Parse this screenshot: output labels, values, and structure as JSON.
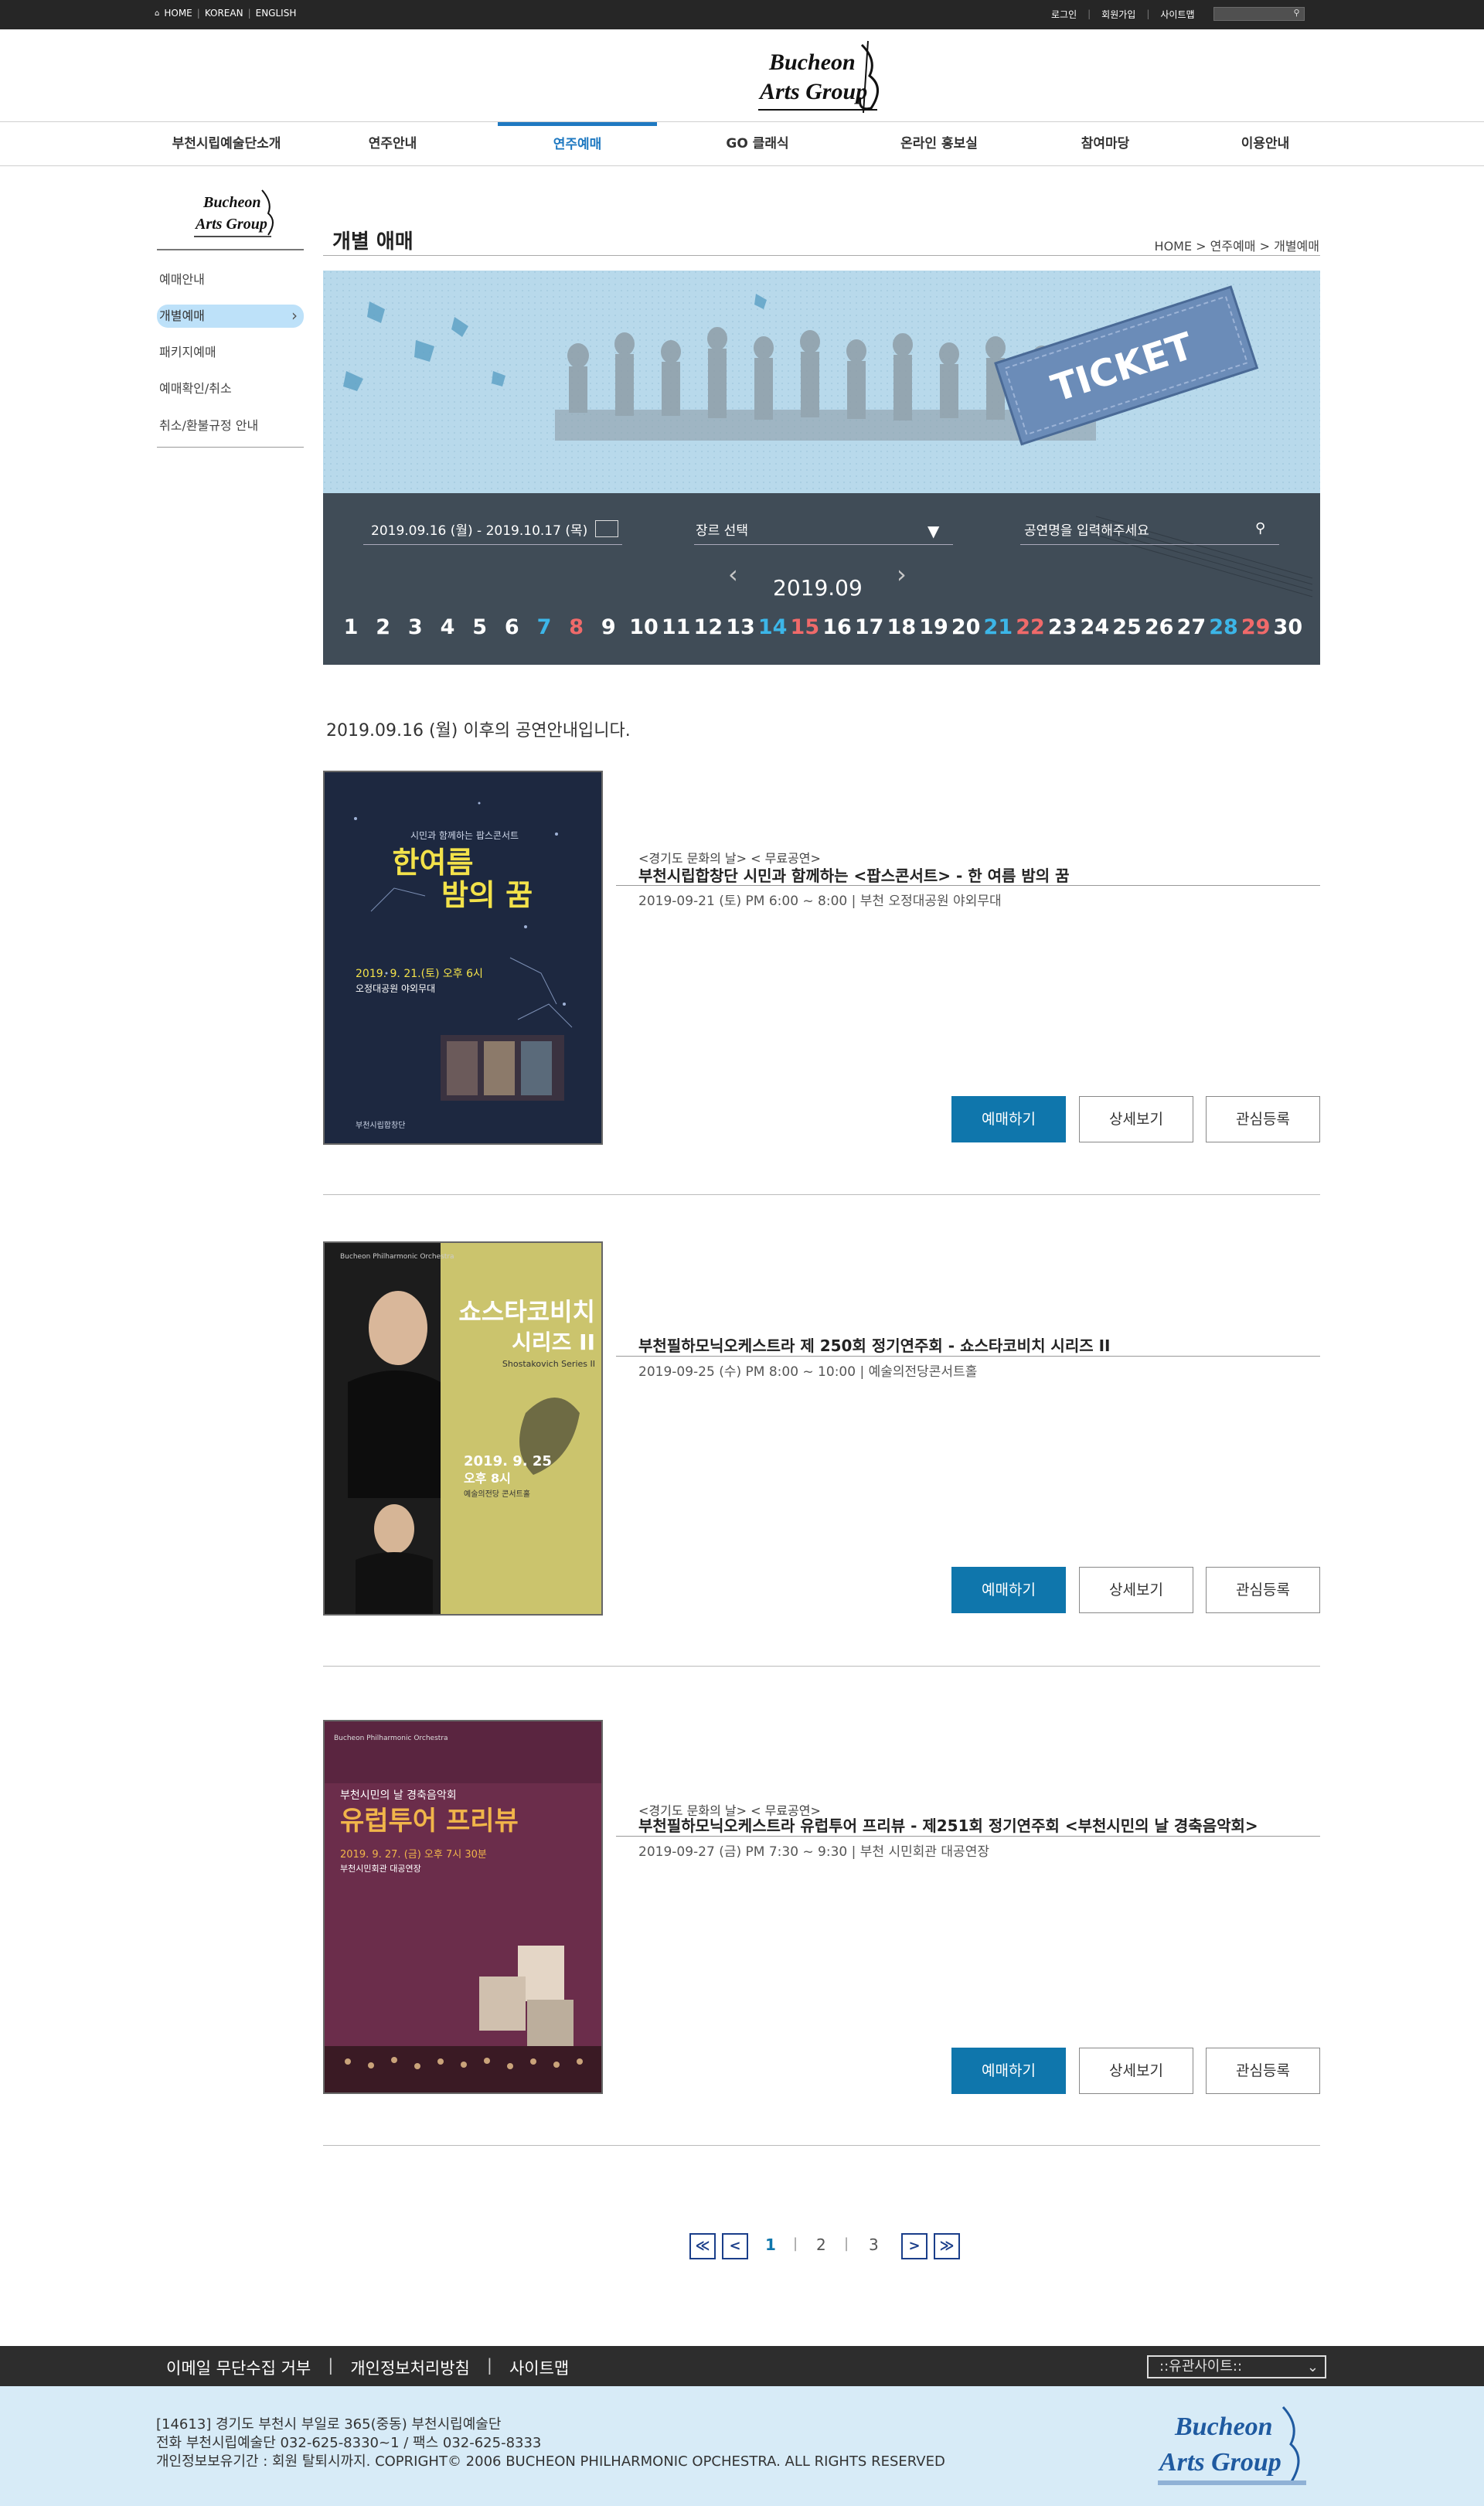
{
  "util": {
    "home": "HOME",
    "korean": "KOREAN",
    "english": "ENGLISH",
    "sep": "|",
    "login": "로그인",
    "join": "회원가입",
    "sitemap": "사이트맵"
  },
  "brand": {
    "logo_line1": "Bucheon",
    "logo_line2": "Arts Group"
  },
  "gnb": [
    {
      "label": "부천시립예술단소개"
    },
    {
      "label": "연주안내"
    },
    {
      "label": "연주예매"
    },
    {
      "label": "GO 클래식"
    },
    {
      "label": "온라인 홍보실"
    },
    {
      "label": "참여마당"
    },
    {
      "label": "이용안내"
    }
  ],
  "lnb": [
    {
      "label": "예매안내"
    },
    {
      "label": "개별예매"
    },
    {
      "label": "패키지예매"
    },
    {
      "label": "예매확인/취소"
    },
    {
      "label": "취소/환불규정 안내"
    }
  ],
  "page": {
    "title": "개별 애매",
    "breadcrumb": "HOME > 연주예매 > 개별예매"
  },
  "hero": {
    "ticket_text": "TICKET"
  },
  "filter": {
    "date_range": "2019.09.16 (월) - 2019.10.17 (목)",
    "genre": "장르 선택",
    "search_placeholder": "공연명을 입력해주세요",
    "month": "2019.09",
    "prev": "‹",
    "next": "›",
    "days": [
      "1",
      "2",
      "3",
      "4",
      "5",
      "6",
      "7",
      "8",
      "9",
      "10",
      "11",
      "12",
      "13",
      "14",
      "15",
      "16",
      "17",
      "18",
      "19",
      "20",
      "21",
      "22",
      "23",
      "24",
      "25",
      "26",
      "27",
      "28",
      "29",
      "30"
    ],
    "colors": {
      "sat": "#3cb6e8",
      "sun": "#f06a6a",
      "normal": "#ffffff"
    }
  },
  "summary": "2019.09.16 (월) 이후의 공연안내입니다.",
  "events": [
    {
      "tag": "<경기도 문화의 날> < 무료공연>",
      "title": "부천시립합창단 시민과 함께하는 <팝스콘서트> - 한 여름 밤의 꿈",
      "info": "2019-09-21 (토) PM 6:00 ~ 8:00 | 부천 오정대공원 야외무대",
      "poster": {
        "subtitle": "시민과 함께하는 팝스콘서트",
        "title1": "한여름",
        "title2": "밤의 꿈",
        "date": "2019. 9. 21.(토) 오후 6시",
        "place": "오정대공원 야외무대",
        "small": "부천시립합창단"
      },
      "btn_book": "예매하기",
      "btn_detail": "상세보기",
      "btn_fav": "관심등록"
    },
    {
      "tag": "",
      "title": "부천필하모닉오케스트라 제 250회 정기연주회 - 쇼스타코비치 시리즈 II",
      "info": "2019-09-25 (수) PM 8:00 ~ 10:00 | 예술의전당콘서트홀",
      "poster": {
        "small": "Bucheon Philharmonic Orchestra",
        "title1": "쇼스타코비치",
        "title2": "시리즈 II",
        "en": "Shostakovich Series II",
        "date": "2019. 9. 25",
        "time": "오후 8시",
        "place": "예술의전당 콘서트홀"
      },
      "btn_book": "예매하기",
      "btn_detail": "상세보기",
      "btn_fav": "관심등록"
    },
    {
      "tag": "<경기도 문화의 날> < 무료공연>",
      "title": "부천필하모닉오케스트라 유럽투어 프리뷰 - 제251회 정기연주회 <부천시민의 날 경축음악회>",
      "info": "2019-09-27 (금) PM 7:30 ~ 9:30 | 부천 시민회관 대공연장",
      "poster": {
        "small": "Bucheon Philharmonic Orchestra",
        "sub": "부천시민의 날 경축음악회",
        "title1": "유럽투어 프리뷰",
        "date": "2019. 9. 27. (금) 오후 7시 30분",
        "place": "부천시민회관 대공연장"
      },
      "btn_book": "예매하기",
      "btn_detail": "상세보기",
      "btn_fav": "관심등록"
    }
  ],
  "paging": {
    "first": "≪",
    "prev": "<",
    "next": ">",
    "last": "≫",
    "pages": [
      "1",
      "2",
      "3"
    ],
    "sep": "|"
  },
  "footer": {
    "link1": "이메일 무단수집 거부",
    "link2": "개인정보처리방침",
    "link3": "사이트맵",
    "sep": "|",
    "family": "::유관사이트::",
    "addr1": "[14613] 경기도 부천시 부일로 365(중동) 부천시립예술단",
    "addr2": "전화 부천시립예술단 032-625-8330~1 / 팩스 032-625-8333",
    "addr3": "개인정보보유기간 : 회원 탈퇴시까지. COPRIGHT© 2006 BUCHEON PHILHARMONIC OPCHESTRA. ALL RIGHTS RESERVED"
  }
}
